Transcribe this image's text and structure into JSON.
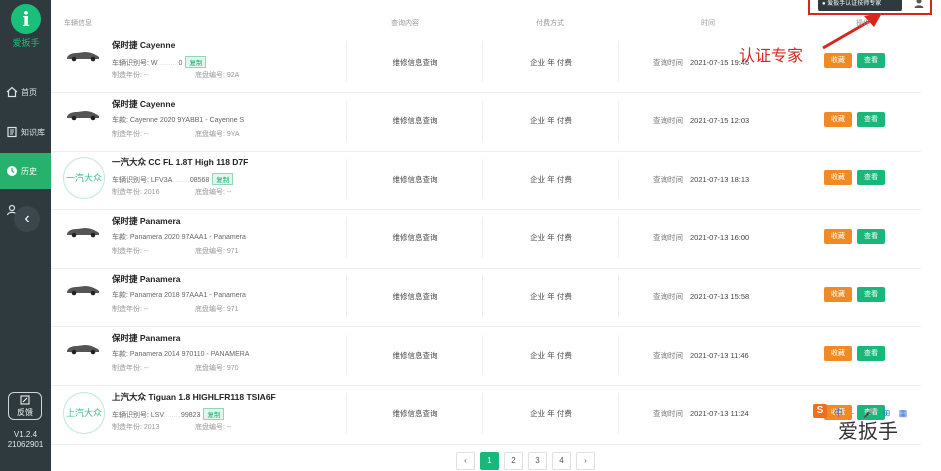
{
  "app": {
    "logo_letter": "i",
    "logo_text": "爱扳手",
    "version": "V1.2.4",
    "build": "21062901",
    "feedback_label": "反馈"
  },
  "sidebar": {
    "items": [
      {
        "label": "首页",
        "icon": "home-icon"
      },
      {
        "label": "知识库",
        "icon": "book-icon"
      },
      {
        "label": "历史",
        "icon": "history-icon"
      },
      {
        "label": "",
        "icon": "user-icon"
      }
    ],
    "active_index": 2
  },
  "header": {
    "expert_button": "爱扳手认证技师专家"
  },
  "annotation": {
    "text": "认证专家",
    "color": "#d9261c"
  },
  "table": {
    "columns": [
      "车辆信息",
      "查询内容",
      "付费方式",
      "时间",
      "操作"
    ],
    "time_label": "查询时间",
    "fav_label": "收藏",
    "view_label": "查看",
    "rows": [
      {
        "title": "保时捷 Cayenne",
        "line1": "车辆识别号: W",
        "line1_masked": "...........",
        "line1_tail": "0",
        "tag": "复制",
        "line2a": "制造年份: --",
        "line2b": "底盘编号: 92A",
        "content": "维修信息查询",
        "pay": "企业 年 付费",
        "time": "2021-07-15 19:46",
        "logo": "car"
      },
      {
        "title": "保时捷 Cayenne",
        "line1": "车款: Cayenne 2020 9YABB1 - Cayenne S",
        "line1_masked": "",
        "line1_tail": "",
        "tag": "",
        "line2a": "制造年份: --",
        "line2b": "底盘编号: 9YA",
        "content": "维修信息查询",
        "pay": "企业 年 付费",
        "time": "2021-07-15 12:03",
        "logo": "car"
      },
      {
        "title": "一汽大众 CC FL 1.8T High 118 D7F",
        "line1": "车辆识别号: LFV3A",
        "line1_masked": ".........",
        "line1_tail": "08568",
        "tag": "复制",
        "line2a": "制造年份: 2016",
        "line2b": "底盘编号: --",
        "content": "维修信息查询",
        "pay": "企业 年 付费",
        "time": "2021-07-13 18:13",
        "logo": "一汽大众"
      },
      {
        "title": "保时捷 Panamera",
        "line1": "车款: Panamera 2020 97AAA1 - Panamera",
        "line1_masked": "",
        "line1_tail": "",
        "tag": "",
        "line2a": "制造年份: --",
        "line2b": "底盘编号: 971",
        "content": "维修信息查询",
        "pay": "企业 年 付费",
        "time": "2021-07-13 16:00",
        "logo": "car"
      },
      {
        "title": "保时捷 Panamera",
        "line1": "车款: Panamera 2018 97AAA1 - Panamera",
        "line1_masked": "",
        "line1_tail": "",
        "tag": "",
        "line2a": "制造年份: --",
        "line2b": "底盘编号: 971",
        "content": "维修信息查询",
        "pay": "企业 年 付费",
        "time": "2021-07-13 15:58",
        "logo": "car"
      },
      {
        "title": "保时捷 Panamera",
        "line1": "车款: Panamera 2014 970110 - PANAMERA",
        "line1_masked": "",
        "line1_tail": "",
        "tag": "",
        "line2a": "制造年份: --",
        "line2b": "底盘编号: 970",
        "content": "维修信息查询",
        "pay": "企业 年 付费",
        "time": "2021-07-13 11:46",
        "logo": "car"
      },
      {
        "title": "上汽大众 Tiguan 1.8 HIGHLFR118 TSIA6F",
        "line1": "车辆识别号: LSV",
        "line1_masked": ".........",
        "line1_tail": "99823",
        "tag": "复制",
        "line2a": "制造年份: 2013",
        "line2b": "底盘编号: --",
        "content": "维修信息查询",
        "pay": "企业 年 付费",
        "time": "2021-07-13 11:24",
        "logo": "上汽大众"
      }
    ]
  },
  "pagination": {
    "prev": "‹",
    "pages": [
      "1",
      "2",
      "3",
      "4"
    ],
    "next": "›",
    "current": "1"
  },
  "watermark": {
    "text": "爱扳手",
    "logo_letter": "S",
    "tools": "中 · 🎤 ⊞ ▦"
  }
}
